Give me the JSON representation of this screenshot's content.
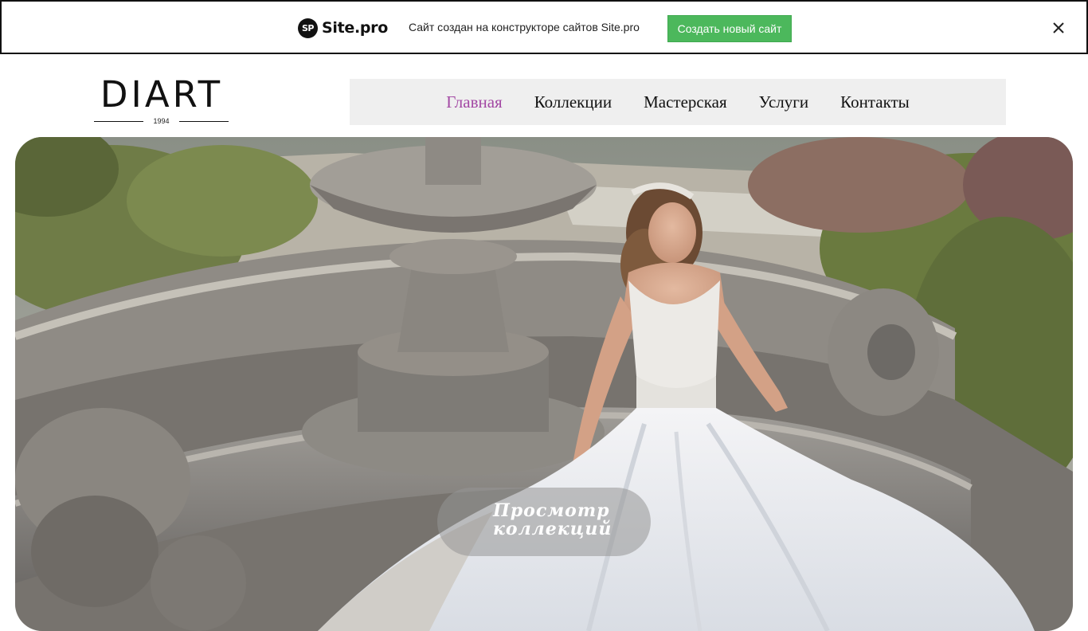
{
  "promo": {
    "badge": "SP",
    "brand": "Site.pro",
    "text": "Сайт создан на конструкторе сайтов Site.pro",
    "button_label": "Создать новый сайт",
    "button_color": "#4cb85c",
    "close_icon": "close-icon"
  },
  "header": {
    "logo_text": "DIART",
    "logo_year": "1994"
  },
  "nav": {
    "active_color": "#a349a4",
    "items": [
      {
        "label": "Главная"
      },
      {
        "label": "Коллекции"
      },
      {
        "label": "Мастерская"
      },
      {
        "label": "Услуги"
      },
      {
        "label": "Контакты"
      }
    ]
  },
  "hero": {
    "image": "bride-by-fountain-photo",
    "cta_label": "Просмотр коллекций"
  }
}
